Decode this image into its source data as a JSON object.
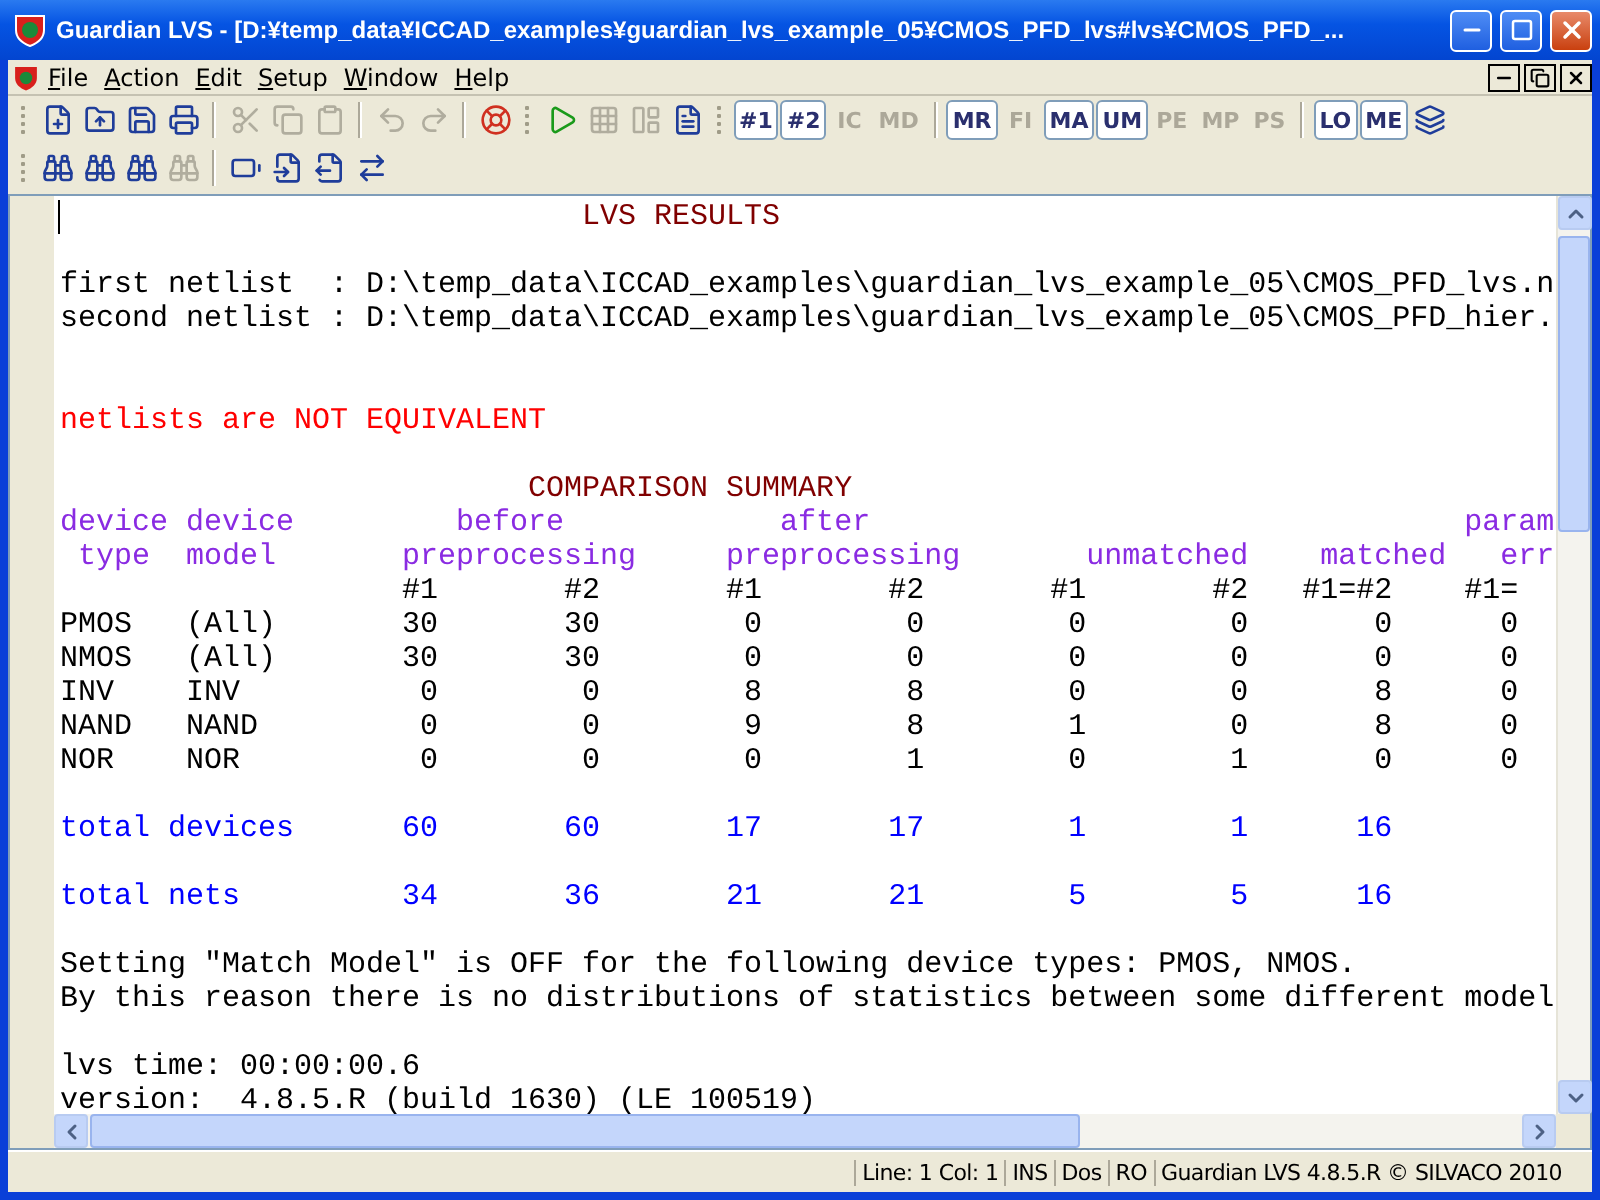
{
  "window": {
    "title": "Guardian LVS - [D:¥temp_data¥ICCAD_examples¥guardian_lvs_example_05¥CMOS_PFD_lvs#lvs¥CMOS_PFD_..."
  },
  "menu": [
    "File",
    "Action",
    "Edit",
    "Setup",
    "Window",
    "Help"
  ],
  "toolbars": [
    {
      "items": [
        {
          "kind": "grip"
        },
        {
          "kind": "icon",
          "disabled": false
        },
        {
          "kind": "icon",
          "disabled": false
        },
        {
          "kind": "icon",
          "disabled": false
        },
        {
          "kind": "icon",
          "disabled": false
        },
        {
          "kind": "separator"
        },
        {
          "kind": "icon",
          "disabled": true
        },
        {
          "kind": "icon",
          "disabled": true
        },
        {
          "kind": "icon",
          "disabled": true
        },
        {
          "kind": "separator"
        },
        {
          "kind": "icon",
          "disabled": true
        },
        {
          "kind": "icon",
          "disabled": true
        },
        {
          "kind": "separator"
        },
        {
          "kind": "icon",
          "disabled": false
        },
        {
          "kind": "grip"
        },
        {
          "kind": "icon",
          "disabled": false
        },
        {
          "kind": "icon",
          "disabled": true
        },
        {
          "kind": "icon",
          "disabled": true
        },
        {
          "kind": "icon",
          "disabled": false
        },
        {
          "kind": "grip"
        },
        {
          "kind": "text",
          "label": "#1",
          "disabled": false
        },
        {
          "kind": "text",
          "label": "#2",
          "disabled": false
        },
        {
          "kind": "text",
          "label": "IC",
          "disabled": true
        },
        {
          "kind": "text",
          "label": "MD",
          "disabled": true
        },
        {
          "kind": "separator"
        },
        {
          "kind": "text",
          "label": "MR",
          "disabled": false
        },
        {
          "kind": "text",
          "label": "FI",
          "disabled": true
        },
        {
          "kind": "text",
          "label": "MA",
          "disabled": false
        },
        {
          "kind": "text",
          "label": "UM",
          "disabled": false
        },
        {
          "kind": "text",
          "label": "PE",
          "disabled": true
        },
        {
          "kind": "text",
          "label": "MP",
          "disabled": true
        },
        {
          "kind": "text",
          "label": "PS",
          "disabled": true
        },
        {
          "kind": "separator"
        },
        {
          "kind": "text",
          "label": "LO",
          "disabled": false
        },
        {
          "kind": "text",
          "label": "ME",
          "disabled": false
        },
        {
          "kind": "icon",
          "disabled": false
        }
      ]
    },
    {
      "items": [
        {
          "kind": "grip"
        },
        {
          "kind": "icon",
          "disabled": false
        },
        {
          "kind": "icon",
          "disabled": false
        },
        {
          "kind": "icon",
          "disabled": false
        },
        {
          "kind": "icon",
          "disabled": true
        },
        {
          "kind": "separator"
        },
        {
          "kind": "icon",
          "disabled": false
        },
        {
          "kind": "icon",
          "disabled": false
        },
        {
          "kind": "icon",
          "disabled": false
        },
        {
          "kind": "icon",
          "disabled": false
        }
      ]
    }
  ],
  "document": {
    "lines": [
      {
        "kind": "text",
        "caret": true,
        "segments": [
          {
            "text": "                             LVS RESULTS",
            "kind": "heading"
          }
        ]
      },
      {
        "kind": "blank"
      },
      {
        "segments": [
          {
            "text": "first netlist  : D:\\temp_data\\ICCAD_examples\\guardian_lvs_example_05\\CMOS_PFD_lvs.n",
            "kind": "plain"
          }
        ]
      },
      {
        "segments": [
          {
            "text": "second netlist : D:\\temp_data\\ICCAD_examples\\guardian_lvs_example_05\\CMOS_PFD_hier.",
            "kind": "plain"
          }
        ]
      },
      {
        "kind": "blank"
      },
      {
        "kind": "blank"
      },
      {
        "segments": [
          {
            "text": "netlists are NOT EQUIVALENT",
            "kind": "alert"
          }
        ]
      },
      {
        "kind": "blank"
      },
      {
        "segments": [
          {
            "text": "                          COMPARISON SUMMARY",
            "kind": "heading"
          }
        ]
      },
      {
        "segments": [
          {
            "text": "device device         before            after                                 param",
            "kind": "label"
          }
        ]
      },
      {
        "segments": [
          {
            "text": " type  model       preprocessing     preprocessing       unmatched    matched   err",
            "kind": "label"
          }
        ]
      },
      {
        "segments": [
          {
            "text": "                   #1       #2       #1       #2       #1       #2   #1=#2    #1=",
            "kind": "plain"
          }
        ]
      },
      {
        "segments": [
          {
            "text": "PMOS   (All)       30       30        0        0        0        0       0      0",
            "kind": "plain"
          }
        ]
      },
      {
        "segments": [
          {
            "text": "NMOS   (All)       30       30        0        0        0        0       0      0",
            "kind": "plain"
          }
        ]
      },
      {
        "segments": [
          {
            "text": "INV    INV          0        0        8        8        0        0       8      0",
            "kind": "plain"
          }
        ]
      },
      {
        "segments": [
          {
            "text": "NAND   NAND         0        0        9        8        1        0       8      0",
            "kind": "plain"
          }
        ]
      },
      {
        "segments": [
          {
            "text": "NOR    NOR          0        0        0        1        0        1       0      0",
            "kind": "plain"
          }
        ]
      },
      {
        "kind": "blank"
      },
      {
        "segments": [
          {
            "text": "total devices      60       60       17       17        1        1      16",
            "kind": "total"
          }
        ]
      },
      {
        "kind": "blank"
      },
      {
        "segments": [
          {
            "text": "total nets         34       36       21       21        5        5      16",
            "kind": "total"
          }
        ]
      },
      {
        "kind": "blank"
      },
      {
        "segments": [
          {
            "text": "Setting \"Match Model\" is OFF for the following device types: PMOS, NMOS.",
            "kind": "plain"
          }
        ]
      },
      {
        "segments": [
          {
            "text": "By this reason there is no distributions of statistics between some different model",
            "kind": "plain"
          }
        ]
      },
      {
        "kind": "blank"
      },
      {
        "segments": [
          {
            "text": "lvs time: 00:00:00.6",
            "kind": "plain"
          }
        ]
      },
      {
        "segments": [
          {
            "text": "version:  4.8.5.R (build 1630) (LE 100519)",
            "kind": "plain"
          }
        ]
      }
    ]
  },
  "status_bar": [
    "Line: 1 Col: 1",
    "INS",
    "Dos",
    "RO",
    "Guardian LVS 4.8.5.R © SILVACO 2010"
  ]
}
